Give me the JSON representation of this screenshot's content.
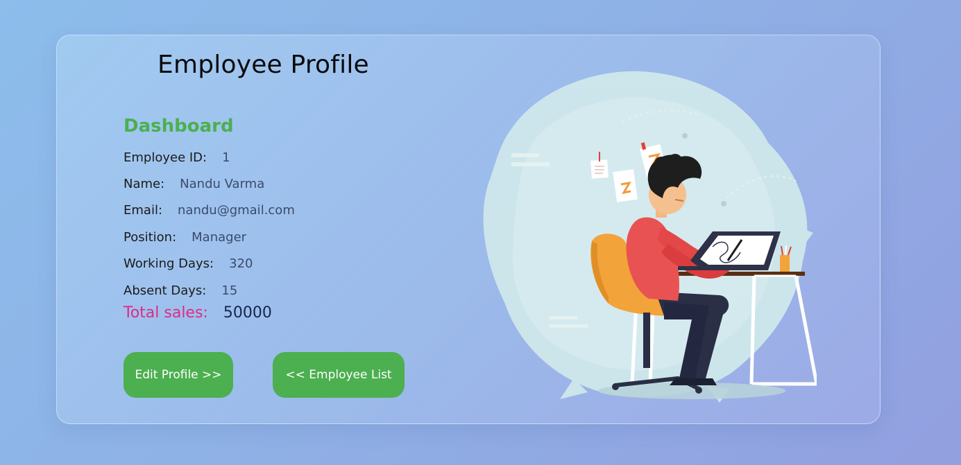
{
  "page": {
    "title": "Employee Profile"
  },
  "dashboard": {
    "heading": "Dashboard",
    "fields": [
      {
        "label": "Employee ID:",
        "value": "1"
      },
      {
        "label": "Name:",
        "value": "Nandu Varma"
      },
      {
        "label": "Email:",
        "value": "nandu@gmail.com"
      },
      {
        "label": "Position:",
        "value": "Manager"
      },
      {
        "label": "Working Days:",
        "value": "320"
      },
      {
        "label": "Absent Days:",
        "value": "15"
      }
    ],
    "total_sales": {
      "label": "Total sales:",
      "value": "50000"
    }
  },
  "buttons": {
    "edit_profile": "Edit Profile >>",
    "employee_list": "<< Employee List"
  },
  "colors": {
    "accent_green": "#4caf50",
    "total_label_pink": "#e02a86",
    "background_start": "#8cbdeb",
    "background_end": "#929fe0"
  },
  "illustration": {
    "icon": "person-drawing-on-tablet-illustration"
  }
}
